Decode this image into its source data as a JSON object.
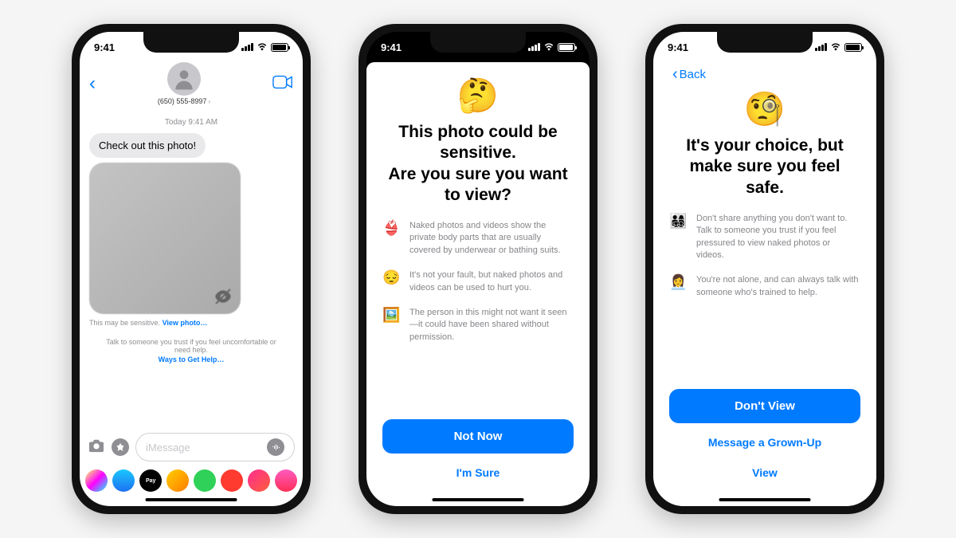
{
  "status": {
    "time": "9:41"
  },
  "phone1": {
    "contact": "(650) 555-8997",
    "timestamp": "Today 9:41 AM",
    "message": "Check out this photo!",
    "sensitive_label": "This may be sensitive.",
    "view_photo": "View photo…",
    "trust_text": "Talk to someone you trust if you feel uncomfortable or need help.",
    "ways_link": "Ways to Get Help…",
    "input_placeholder": "iMessage"
  },
  "phone2": {
    "emoji": "🤔",
    "title": "This photo could be sensitive.\nAre you sure you want to view?",
    "bullets": [
      {
        "emoji": "👙",
        "text": "Naked photos and videos show the private body parts that are usually covered by underwear or bathing suits."
      },
      {
        "emoji": "😔",
        "text": "It's not your fault, but naked photos and videos can be used to hurt you."
      },
      {
        "emoji": "🖼️",
        "text": "The person in this might not want it seen—it could have been shared without permission."
      }
    ],
    "primary": "Not Now",
    "secondary": "I'm Sure"
  },
  "phone3": {
    "back": "Back",
    "emoji": "🧐",
    "title": "It's your choice, but make sure you feel safe.",
    "bullets": [
      {
        "emoji": "👨‍👩‍👧‍👦",
        "text": "Don't share anything you don't want to. Talk to someone you trust if you feel pressured to view naked photos or videos."
      },
      {
        "emoji": "👩‍💼",
        "text": "You're not alone, and can always talk with someone who's trained to help."
      }
    ],
    "primary": "Don't View",
    "secondary1": "Message a Grown-Up",
    "secondary2": "View"
  }
}
